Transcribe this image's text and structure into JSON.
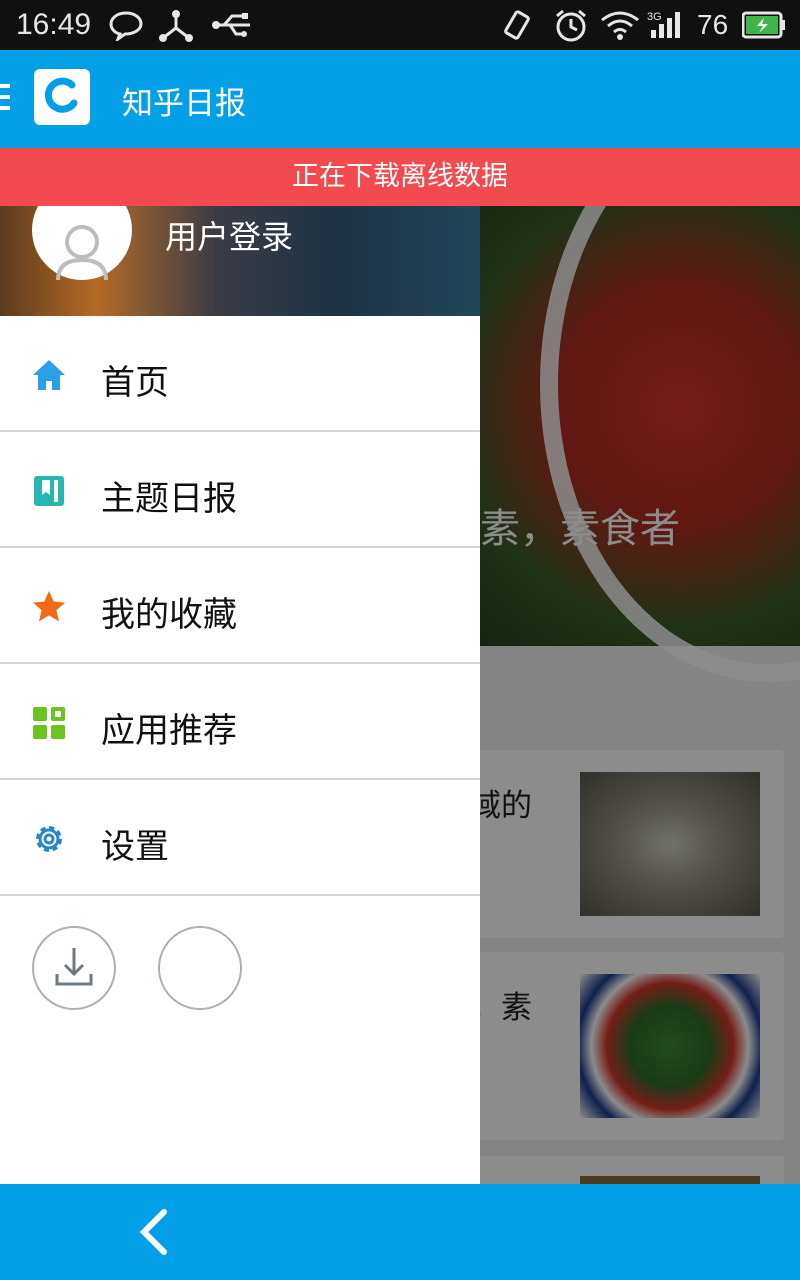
{
  "status_bar": {
    "time": "16:49",
    "battery": "76",
    "network": "3G",
    "icons": [
      "chat-icon",
      "share-icon",
      "usb-icon",
      "rotate-icon",
      "alarm-icon",
      "wifi-icon",
      "signal-icon",
      "battery-icon"
    ]
  },
  "app_bar": {
    "title": "知乎日报",
    "logo": "zhihu-daily-logo",
    "menu_icon": "hamburger-icon"
  },
  "banner": {
    "text": "正在下载离线数据"
  },
  "background": {
    "hero_title": "养素，素食者",
    "cards": [
      {
        "text": "域的"
      },
      {
        "text": "，素"
      }
    ]
  },
  "drawer": {
    "login_label": "用户登录",
    "menu": [
      {
        "label": "首页",
        "icon": "home-icon",
        "color": "#2aa0e8"
      },
      {
        "label": "主题日报",
        "icon": "book-icon",
        "color": "#27b7b0"
      },
      {
        "label": "我的收藏",
        "icon": "star-icon",
        "color": "#ef6b16"
      },
      {
        "label": "应用推荐",
        "icon": "grid-icon",
        "color": "#6cc31f"
      },
      {
        "label": "设置",
        "icon": "gear-icon",
        "color": "#2a86c8"
      }
    ],
    "actions": [
      "download-icon",
      "night-mode-icon"
    ]
  },
  "bottom_bar": {
    "back_icon": "back-icon"
  },
  "colors": {
    "primary": "#03a0e8",
    "banner": "#f24a4e"
  }
}
